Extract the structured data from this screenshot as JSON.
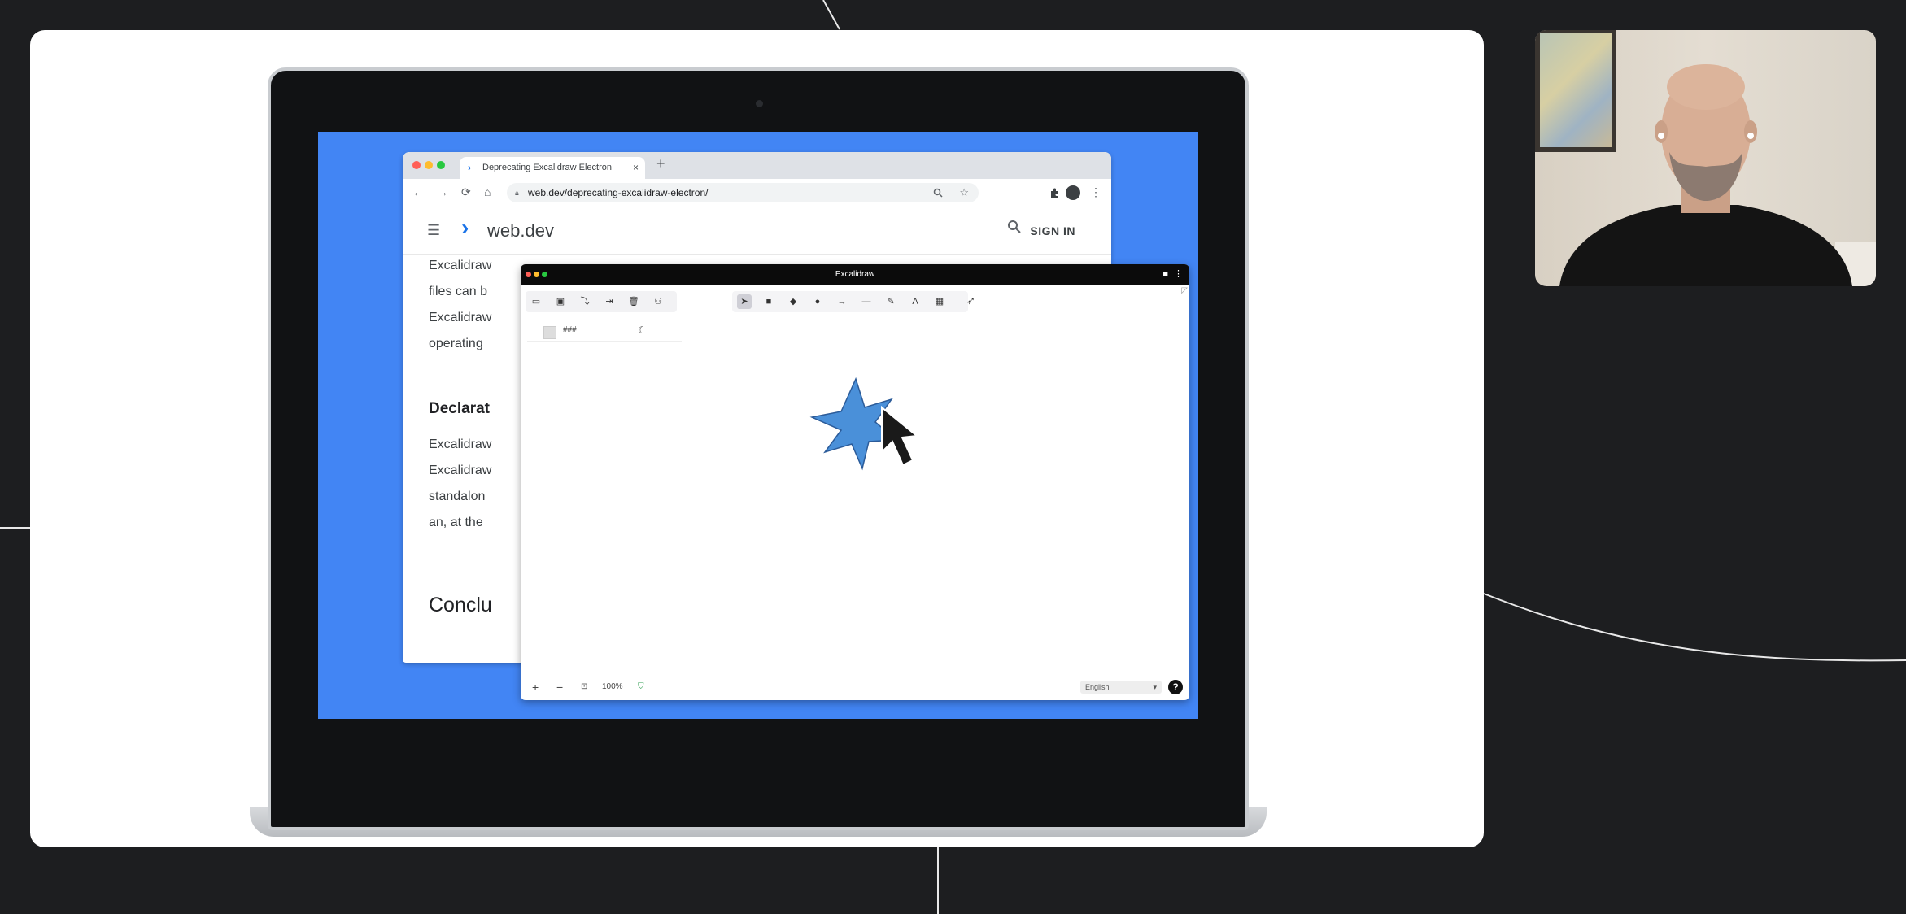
{
  "browser": {
    "tab_title": "Deprecating Excalidraw Electron",
    "tab_close": "×",
    "new_tab": "+",
    "url": "web.dev/deprecating-excalidraw-electron/",
    "nav_icons": {
      "back": "←",
      "forward": "→",
      "reload": "⟳",
      "home": "⌂"
    }
  },
  "site": {
    "logo_mark": "›",
    "logo_text": "web.dev",
    "sign_in": "SIGN IN"
  },
  "article": {
    "line1": "Excalidraw",
    "line2": "files can b",
    "line3": "Excalidraw",
    "line4": "operating",
    "heading": "Declarat",
    "line5": "Excalidraw",
    "line6": "Excalidraw",
    "line7": "standalon",
    "line8": "an, at the",
    "conclusion": "Conclu"
  },
  "excalidraw": {
    "title": "Excalidraw",
    "zoom_level": "100%",
    "zoom_in": "+",
    "zoom_out": "−",
    "language": "English",
    "help": "?",
    "stroke_value": "###"
  },
  "colors": {
    "page_bg": "#1d1e20",
    "screen_blue": "#4285f4",
    "star_fill": "#4a90d9",
    "brand_blue": "#1a73e8"
  }
}
